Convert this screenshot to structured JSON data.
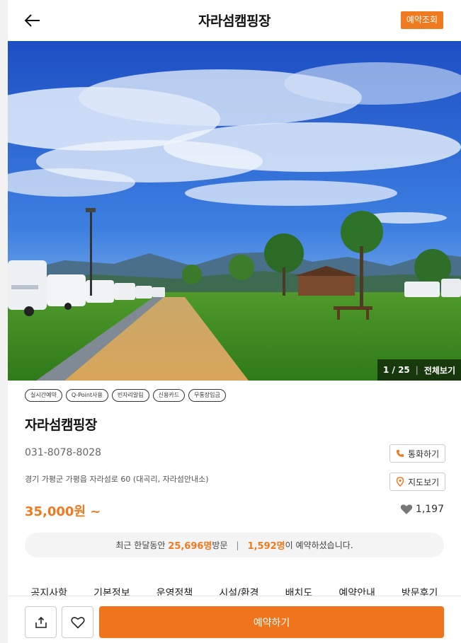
{
  "header": {
    "title": "자라섬캠핑장",
    "reserve_check_label": "예약조회"
  },
  "hero": {
    "current": "1 / 25",
    "view_all": "전체보기"
  },
  "tags": [
    "실시간예약",
    "Q-Point사용",
    "빈자리알림",
    "신용카드",
    "무통장입금"
  ],
  "info": {
    "name": "자라섬캠핑장",
    "phone": "031-8078-8028",
    "address": "경기 가평군 가평읍 자라섬로 60 (대곡리, 자라섬안내소)",
    "call_label": "통화하기",
    "map_label": "지도보기",
    "price": "35,000원 ~",
    "likes": "1,197"
  },
  "stats": {
    "prefix": "최근 한달동안",
    "visits": "25,696명",
    "visits_suffix": "방문",
    "separator": "|",
    "bookings": "1,592명",
    "bookings_suffix": "이 예약하셨습니다."
  },
  "tabs": [
    "공지사항",
    "기본정보",
    "운영정책",
    "시설/환경",
    "배치도",
    "예약안내",
    "방문후기"
  ],
  "bottom": {
    "book_label": "예약하기"
  },
  "colors": {
    "accent": "#f07a1f"
  }
}
